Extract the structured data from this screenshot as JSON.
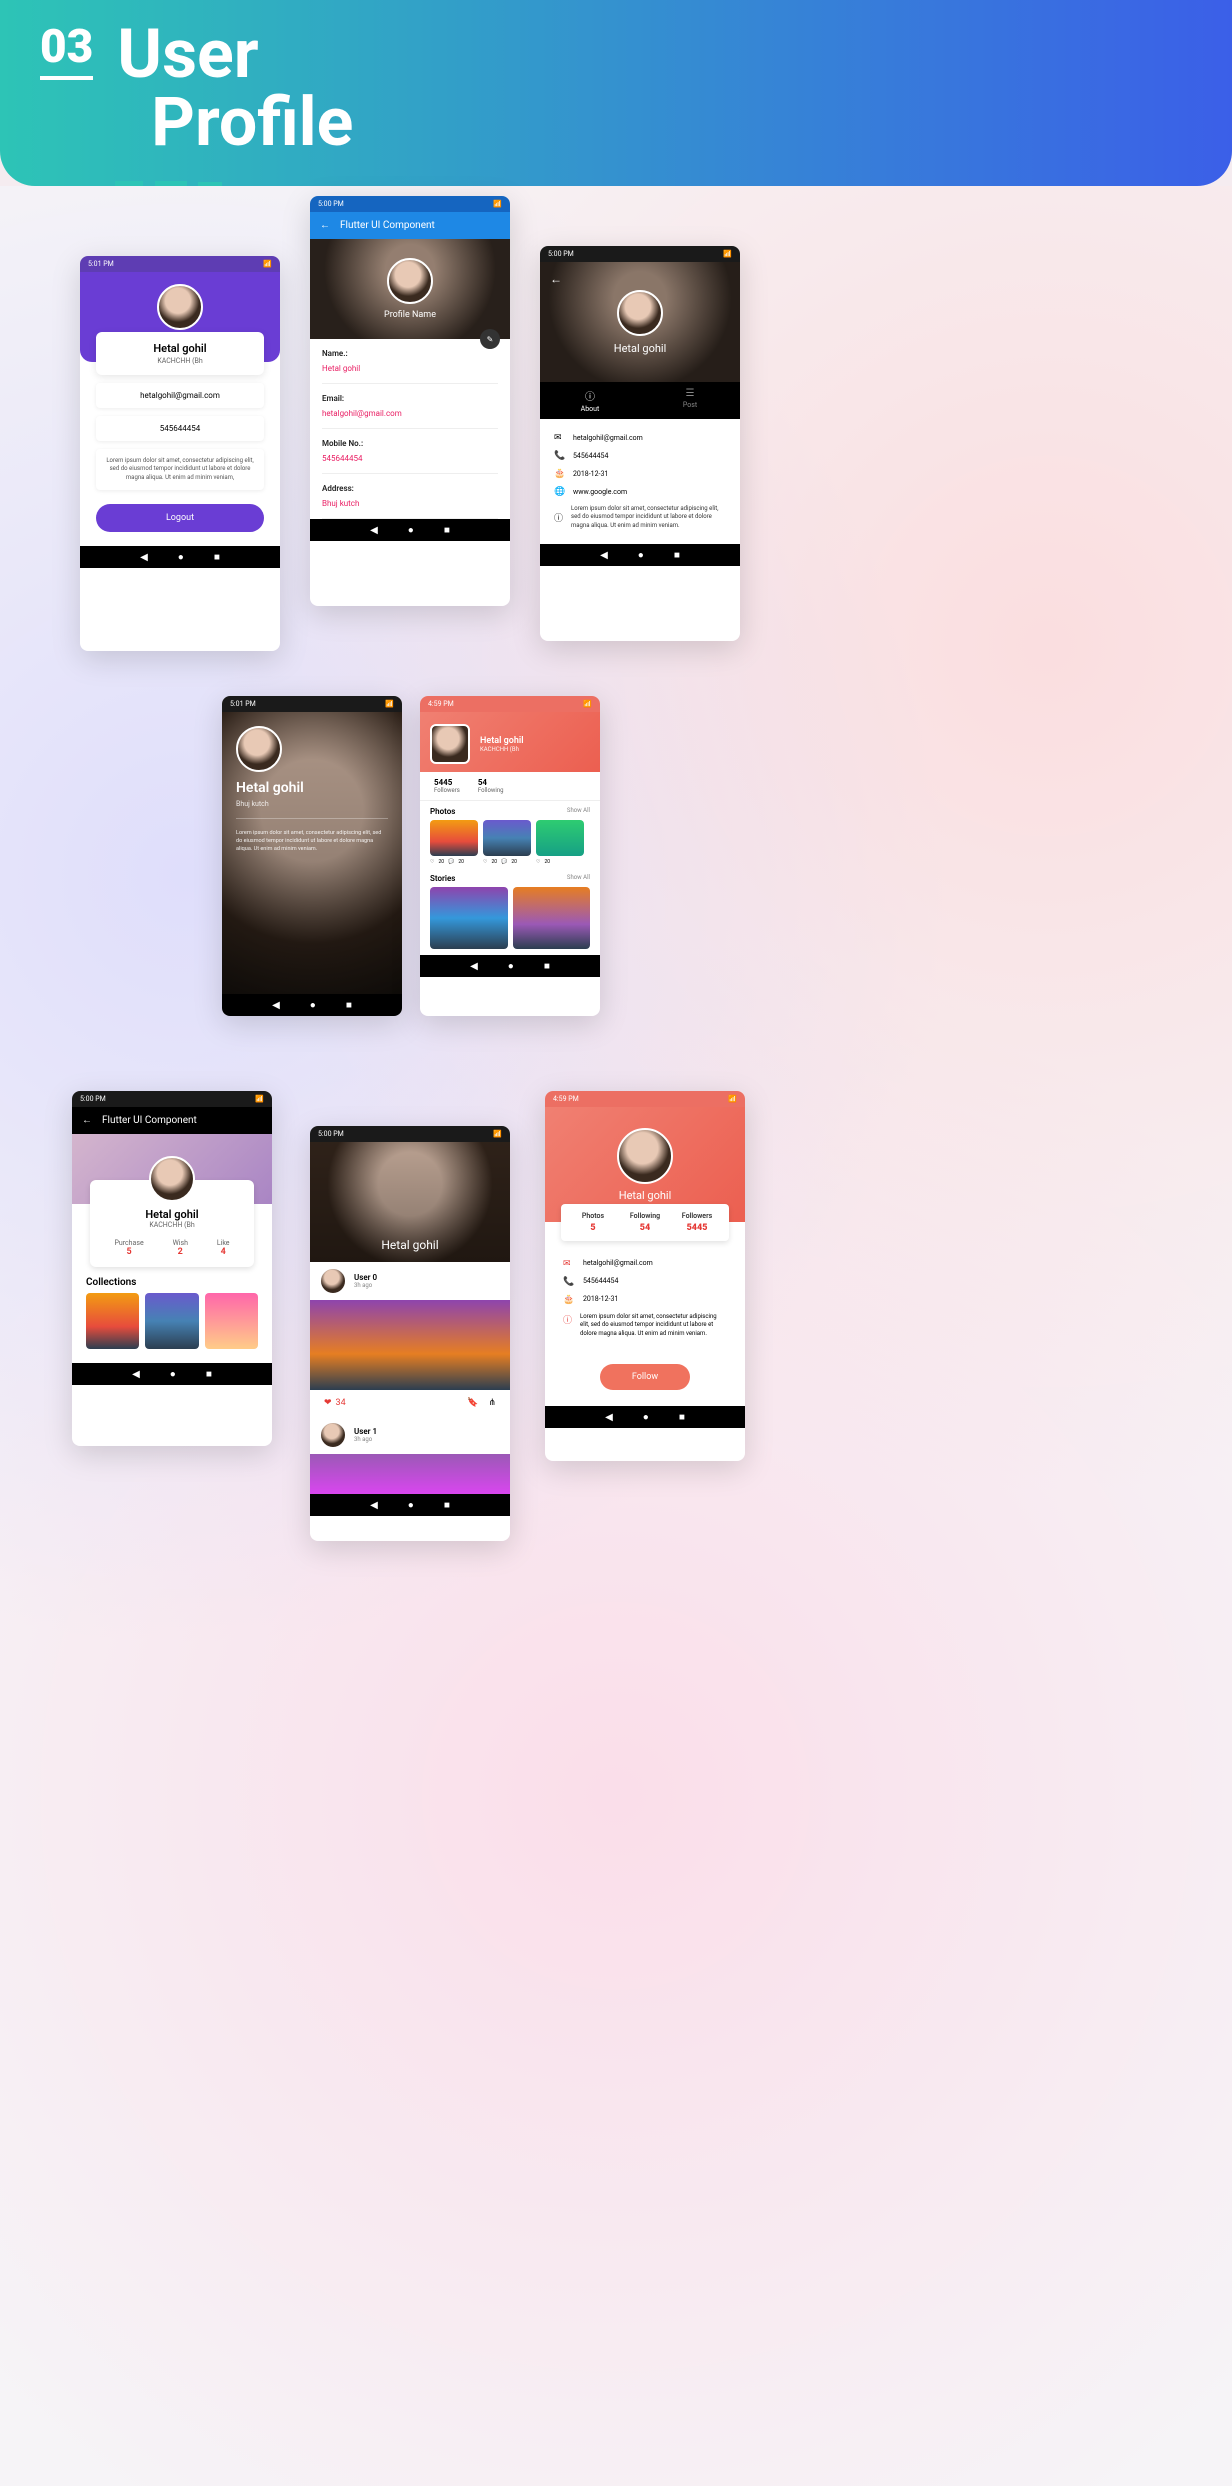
{
  "header": {
    "number": "03",
    "title_line1": "User",
    "title_line2": "Profile"
  },
  "common": {
    "name": "Hetal gohil",
    "subtitle": "KACHCHH (Bh",
    "email": "hetalgohil@gmail.com",
    "phone": "545644454",
    "date": "2018-12-31",
    "website": "www.google.com",
    "location": "Bhuj kutch",
    "lorem_short": "Lorem ipsum dolor sit amet, consectetur adipiscing elit, sed do eiusmod tempor incididunt ut labore et dolore magna aliqua. Ut enim ad minim veniam,",
    "lorem_med": "Lorem ipsum dolor sit amet, consectetur adipiscing elit, sed do eiusmod tempor incididunt ut labore et dolore magna aliqua. Ut enim ad minim veniam.",
    "appbar_title": "Flutter UI Component"
  },
  "p1": {
    "logout": "Logout"
  },
  "p2": {
    "profile_name": "Profile Name",
    "fields": [
      {
        "label": "Name.:",
        "value": "Hetal gohil"
      },
      {
        "label": "Email:",
        "value": "hetalgohil@gmail.com"
      },
      {
        "label": "Mobile No.:",
        "value": "545644454"
      },
      {
        "label": "Address:",
        "value": "Bhuj kutch"
      }
    ]
  },
  "p3": {
    "tabs": {
      "about": "About",
      "post": "Post"
    }
  },
  "p5": {
    "stats": [
      {
        "value": "5445",
        "label": "Followers"
      },
      {
        "value": "54",
        "label": "Following"
      }
    ],
    "photos": "Photos",
    "stories": "Stories",
    "show_all": "Show All",
    "likes": "20",
    "comments": "20"
  },
  "p6": {
    "stats": [
      {
        "label": "Purchase",
        "value": "5"
      },
      {
        "label": "Wish",
        "value": "2"
      },
      {
        "label": "Like",
        "value": "4"
      }
    ],
    "collections": "Collections"
  },
  "p7": {
    "posts": [
      {
        "user": "User 0",
        "time": "3h ago",
        "likes": "34"
      },
      {
        "user": "User 1",
        "time": "3h ago"
      }
    ]
  },
  "p8": {
    "stats": [
      {
        "label": "Photos",
        "value": "5"
      },
      {
        "label": "Following",
        "value": "54"
      },
      {
        "label": "Followers",
        "value": "5445"
      }
    ],
    "follow": "Follow"
  },
  "status": {
    "time_501": "5:01 PM",
    "time_500": "5:00 PM",
    "time_459": "4:59 PM"
  }
}
